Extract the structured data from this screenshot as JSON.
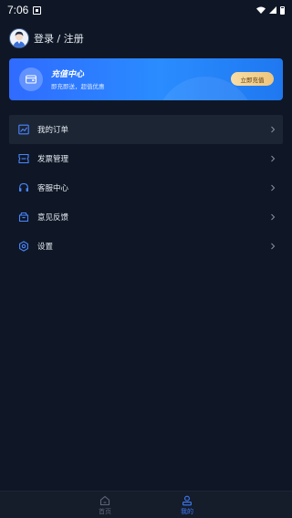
{
  "status_bar": {
    "time": "7:06"
  },
  "user": {
    "login_label": "登录 / 注册"
  },
  "recharge_card": {
    "title": "充值中心",
    "subtitle": "即充即送，超值优惠",
    "button_label": "立即充值"
  },
  "menu": {
    "items": [
      {
        "label": "我的订单",
        "icon": "trend-chart-icon"
      },
      {
        "label": "发票管理",
        "icon": "invoice-icon"
      },
      {
        "label": "客服中心",
        "icon": "headset-icon"
      },
      {
        "label": "意见反馈",
        "icon": "feedback-box-icon"
      },
      {
        "label": "设置",
        "icon": "gear-icon"
      }
    ]
  },
  "tabs": [
    {
      "label": "首页",
      "icon": "home-icon",
      "active": false
    },
    {
      "label": "我的",
      "icon": "person-icon",
      "active": true
    }
  ],
  "colors": {
    "background": "#0f1726",
    "accent": "#3e7bfa",
    "card_gradient_start": "#2f6bff",
    "button_gold": "#eec57c"
  }
}
